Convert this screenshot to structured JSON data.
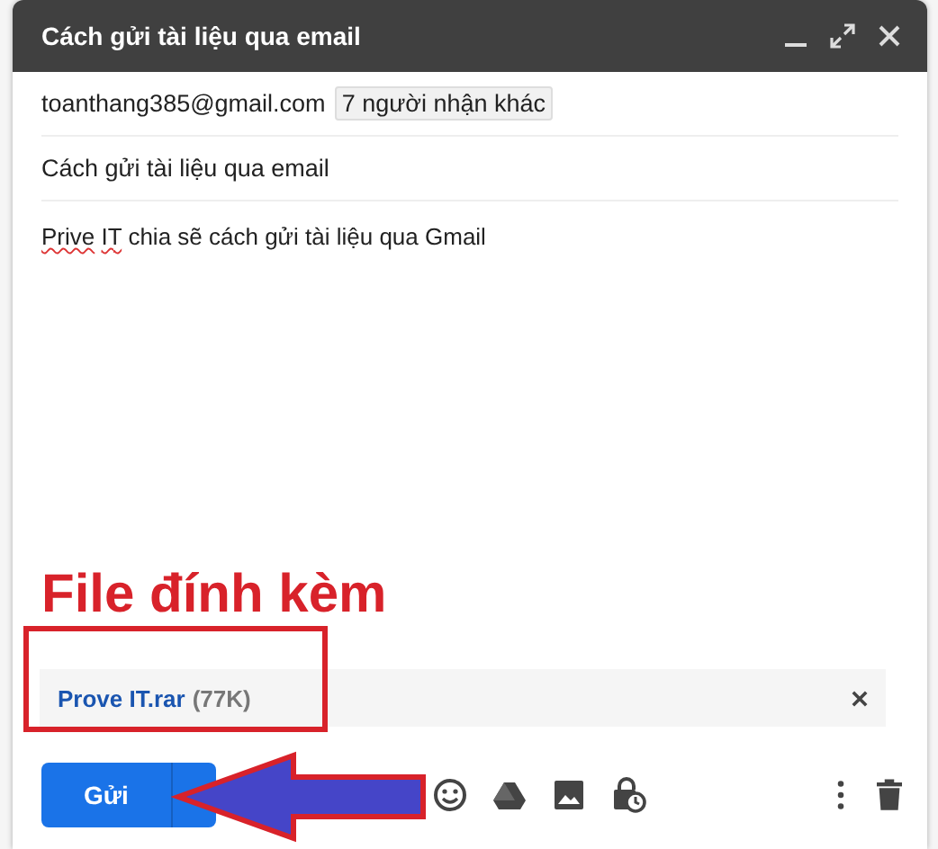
{
  "window": {
    "title": "Cách gửi tài liệu qua email"
  },
  "recipients": {
    "address": "toanthang385@gmail.com",
    "more": "7 người nhận khác"
  },
  "subject": "Cách gửi tài liệu qua email",
  "body": [
    {
      "text": "Prive",
      "misspelled": true
    },
    {
      "text": "IT",
      "misspelled": true
    },
    {
      "text": "chia sẽ cách gửi tài liệu qua Gmail",
      "misspelled": false
    }
  ],
  "attachment": {
    "name": "Prove IT.rar",
    "size": "(77K)"
  },
  "send_button": {
    "label": "Gửi"
  },
  "annotation": {
    "label": "File đính kèm"
  }
}
